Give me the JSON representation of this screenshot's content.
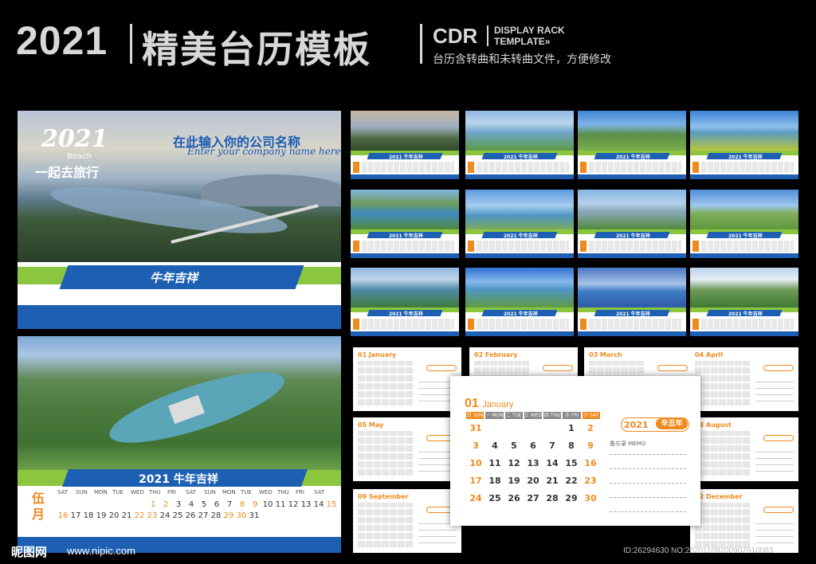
{
  "header": {
    "year": "2021",
    "title": "精美台历模板",
    "format": "CDR",
    "rack_line1": "DISPLAY RACK",
    "rack_line2": "TEMPLATE»",
    "subtitle": "台历含转曲和未转曲文件，方便修改"
  },
  "cover": {
    "logo_year": "2021",
    "logo_beach": "Beach",
    "slogan": "一起去旅行",
    "company_cn": "在此输入你的公司名称",
    "company_en": "Enter your company name here",
    "tab_text": "牛年吉祥"
  },
  "may_page": {
    "tab_text": "2021 牛年吉祥",
    "month_cn_1": "伍",
    "month_cn_2": "月",
    "weekdays": [
      "SAT",
      "SUN",
      "MON",
      "TUE",
      "WED",
      "THU",
      "FRI",
      "SAT",
      "SUN",
      "MON",
      "TUE",
      "WED",
      "THU",
      "FRI",
      "SAT"
    ],
    "row1": [
      "",
      "",
      "",
      "",
      "",
      "",
      "",
      "1",
      "2",
      "3",
      "4",
      "5",
      "6",
      "7",
      "8",
      "9",
      "10",
      "11",
      "12",
      "13",
      "14",
      "15"
    ],
    "row2": [
      "16",
      "17",
      "18",
      "19",
      "20",
      "21",
      "22",
      "23",
      "24",
      "25",
      "26",
      "27",
      "28",
      "29",
      "30",
      "31"
    ]
  },
  "thumb_tab": "2021 牛年吉祥",
  "month_pages": [
    {
      "label": "01 January"
    },
    {
      "label": "02 February"
    },
    {
      "label": "03 March"
    },
    {
      "label": "04 April"
    },
    {
      "label": "05 May"
    },
    {
      "label": "08 August"
    },
    {
      "label": "09 September"
    },
    {
      "label": "12 December"
    }
  ],
  "january": {
    "num": "01",
    "name": "January",
    "weekdays": [
      "日 SUN",
      "一 MON",
      "二 TUE",
      "三 WED",
      "四 THU",
      "五 FRI",
      "六 SAT"
    ],
    "weeks": [
      [
        "31",
        "",
        "",
        "",
        "",
        "1",
        "2"
      ],
      [
        "3",
        "4",
        "5",
        "6",
        "7",
        "8",
        "9"
      ],
      [
        "10",
        "11",
        "12",
        "13",
        "14",
        "15",
        "16"
      ],
      [
        "17",
        "18",
        "19",
        "20",
        "21",
        "22",
        "23"
      ],
      [
        "24",
        "25",
        "26",
        "27",
        "28",
        "29",
        "30"
      ]
    ],
    "badge_year": "2021",
    "badge_ganzhi": "辛丑年",
    "memo": "备忘录 MEMO"
  },
  "footer": {
    "logo": "昵图网",
    "url": "www.nipic.com",
    "id": "ID:26294630 NO:20201109200907610083"
  },
  "colors": {
    "accent_orange": "#f08a1c",
    "brand_blue": "#1d5fb3",
    "brand_green": "#8cc63f"
  }
}
